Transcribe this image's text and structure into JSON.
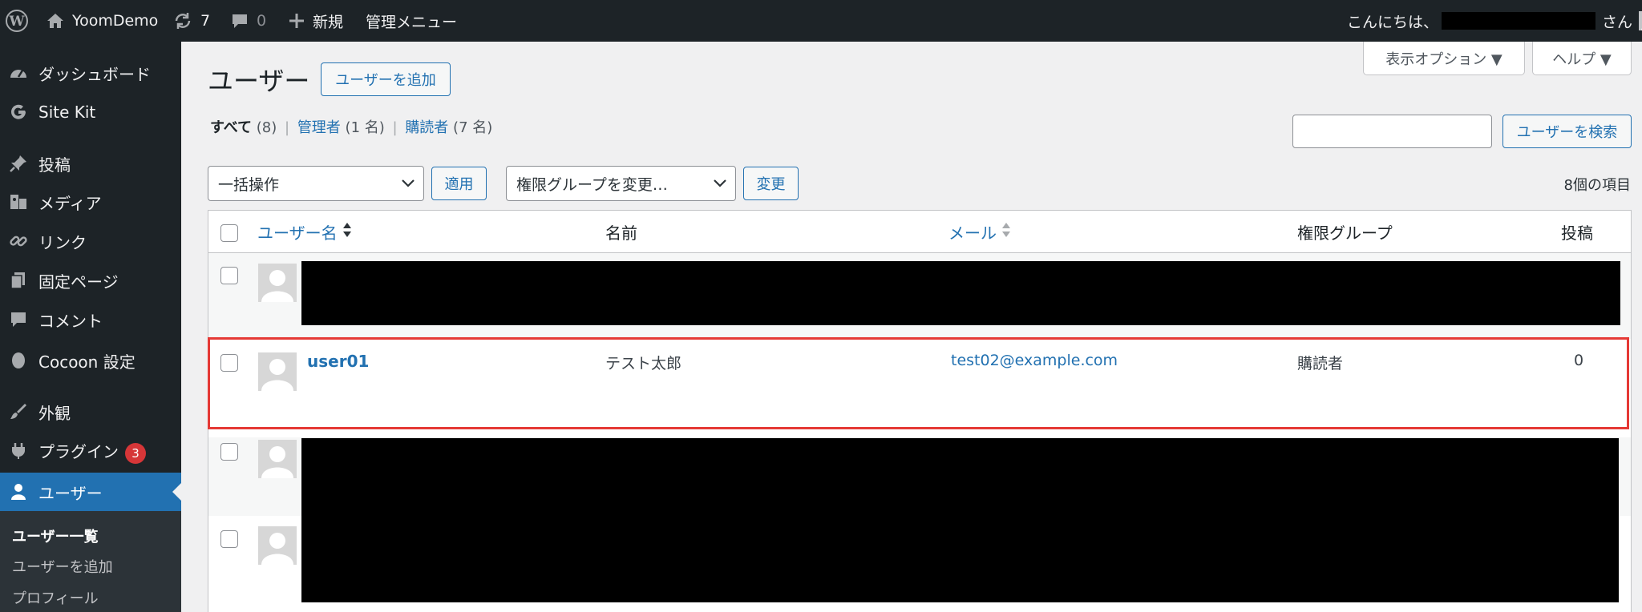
{
  "admin_bar": {
    "site_name": "YoomDemo",
    "updates_count": "7",
    "comments_count": "0",
    "new_label": "新規",
    "admin_menu_label": "管理メニュー",
    "greeting": "こんにちは、",
    "greeting_suffix": "さん"
  },
  "sidebar": {
    "items": [
      {
        "label": "ダッシュボード",
        "icon": "dashboard-icon"
      },
      {
        "label": "Site Kit",
        "icon": "google-g-icon"
      },
      {
        "label": "投稿",
        "icon": "pushpin-icon"
      },
      {
        "label": "メディア",
        "icon": "media-icon"
      },
      {
        "label": "リンク",
        "icon": "link-icon"
      },
      {
        "label": "固定ページ",
        "icon": "pages-icon"
      },
      {
        "label": "コメント",
        "icon": "comment-icon"
      },
      {
        "label": "Cocoon 設定",
        "icon": "cocoon-icon"
      },
      {
        "label": "外観",
        "icon": "brush-icon"
      },
      {
        "label": "プラグイン",
        "icon": "plugin-icon",
        "badge": "3"
      },
      {
        "label": "ユーザー",
        "icon": "user-icon",
        "current": true
      }
    ],
    "submenu": [
      {
        "label": "ユーザー一覧",
        "current": true
      },
      {
        "label": "ユーザーを追加"
      },
      {
        "label": "プロフィール"
      }
    ]
  },
  "screen_meta": {
    "screen_options_label": "表示オプション ▼",
    "help_label": "ヘルプ ▼"
  },
  "page": {
    "title": "ユーザー",
    "add_new_label": "ユーザーを追加"
  },
  "filters": {
    "all_label": "すべて",
    "all_count": "(8)",
    "admin_label": "管理者",
    "admin_count": "(1 名)",
    "subscriber_label": "購読者",
    "subscriber_count": "(7 名)",
    "separator": "|"
  },
  "search": {
    "value": "",
    "button_label": "ユーザーを検索"
  },
  "bulk": {
    "selected": "一括操作",
    "apply_label": "適用",
    "role_selected": "権限グループを変更…",
    "change_label": "変更",
    "item_count": "8個の項目"
  },
  "table": {
    "columns": [
      "ユーザー名",
      "名前",
      "メール",
      "権限グループ",
      "投稿"
    ],
    "highlight_color": "#e53935",
    "rows": [
      {
        "username": "user01",
        "name": "テスト太郎",
        "email": "test02@example.com",
        "role": "購読者",
        "posts": "0"
      }
    ]
  }
}
